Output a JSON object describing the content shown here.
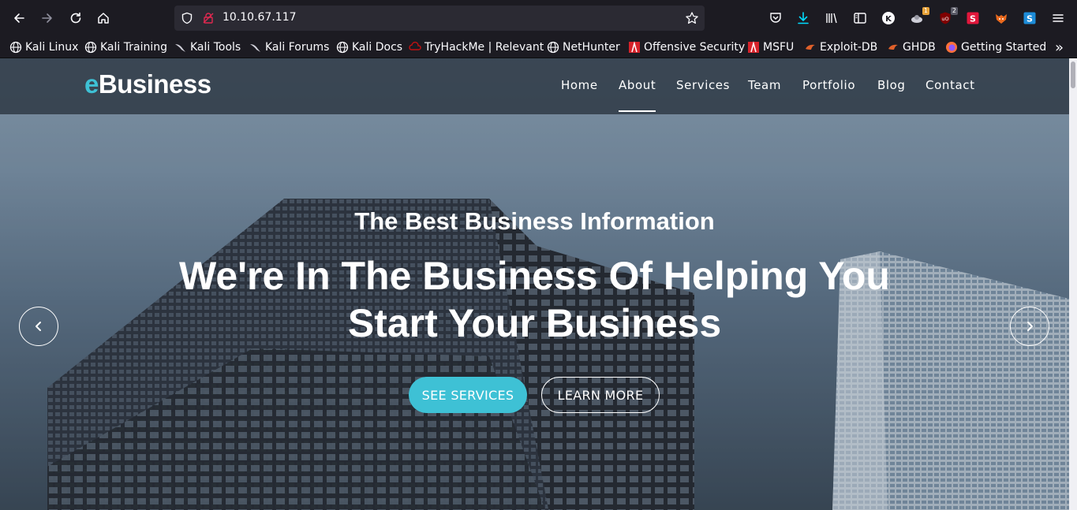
{
  "browser": {
    "url": "10.10.67.117",
    "toolbar_icons": [
      "back-icon",
      "forward-icon",
      "reload-icon",
      "home-icon",
      "shield-icon",
      "lock-icon",
      "star-icon",
      "pocket-icon",
      "download-icon",
      "library-icon",
      "sidebar-icon",
      "extension-k-icon",
      "extension-1-icon",
      "ublock-icon",
      "extension-s-icon",
      "foxyproxy-icon",
      "extension-s-blue-icon",
      "menu-icon"
    ],
    "badges": {
      "ext1": "1",
      "ublock": "2"
    },
    "bookmarks": [
      {
        "label": "Kali Linux",
        "icon": "globe-icon"
      },
      {
        "label": "Kali Training",
        "icon": "globe-icon"
      },
      {
        "label": "Kali Tools",
        "icon": "kali-dragon-icon"
      },
      {
        "label": "Kali Forums",
        "icon": "kali-dragon-icon"
      },
      {
        "label": "Kali Docs",
        "icon": "globe-icon"
      },
      {
        "label": "TryHackMe | Relevant",
        "icon": "tryhackme-icon"
      },
      {
        "label": "NetHunter",
        "icon": "globe-icon"
      },
      {
        "label": "Offensive Security",
        "icon": "offsec-icon"
      },
      {
        "label": "MSFU",
        "icon": "offsec-icon"
      },
      {
        "label": "Exploit-DB",
        "icon": "exploitdb-icon"
      },
      {
        "label": "GHDB",
        "icon": "exploitdb-icon"
      },
      {
        "label": "Getting Started",
        "icon": "firefox-icon"
      }
    ],
    "overflow_label": "»"
  },
  "site": {
    "logo_accent": "e",
    "logo_rest": "Business",
    "accent_color": "#3ec1d5",
    "menu": [
      {
        "label": "Home"
      },
      {
        "label": "About",
        "active": true
      },
      {
        "label": "Services"
      },
      {
        "label": "Team"
      },
      {
        "label": "Portfolio"
      },
      {
        "label": "Blog"
      },
      {
        "label": "Contact"
      }
    ]
  },
  "hero": {
    "subtitle": "The Best Business Information",
    "title_line1": "We're In The Business Of Helping You",
    "title_line2": "Start Your Business",
    "primary_button": "SEE SERVICES",
    "secondary_button": "LEARN MORE"
  }
}
